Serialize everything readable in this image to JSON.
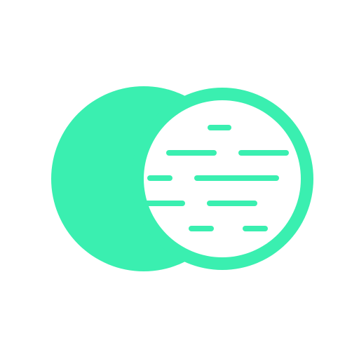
{
  "icon": {
    "name": "overlapping-planets-icon",
    "colors": {
      "accent": "#3AEFB0",
      "background": "#FFFFFF"
    }
  }
}
